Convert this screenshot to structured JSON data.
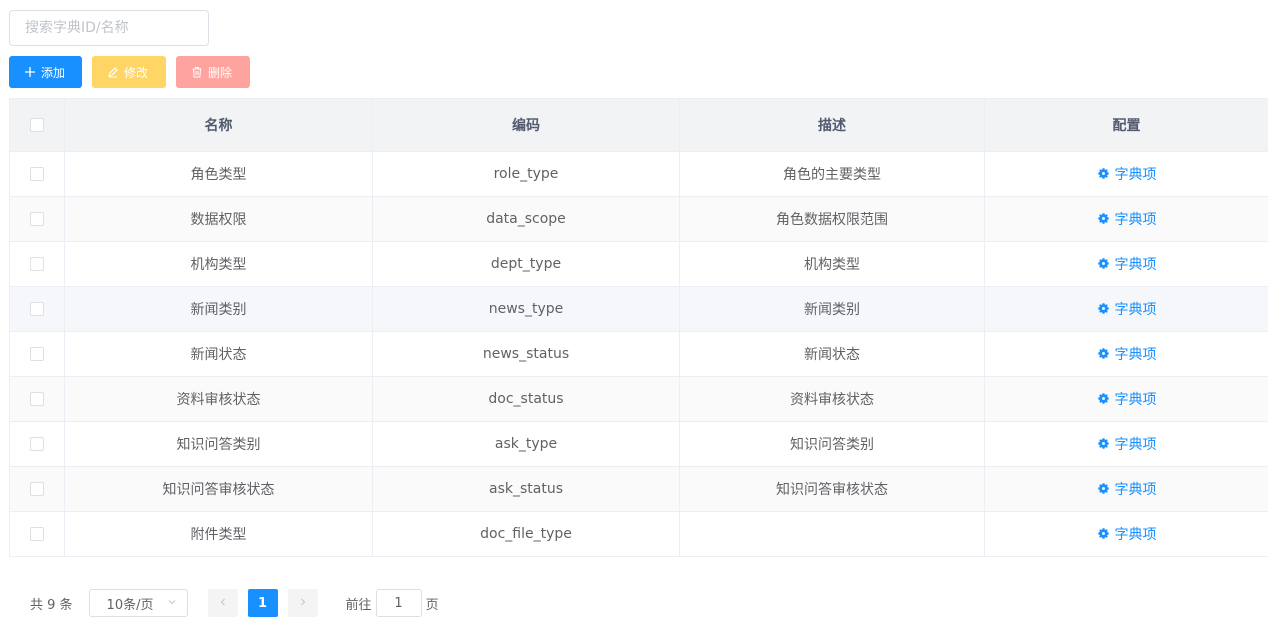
{
  "search": {
    "placeholder": "搜索字典ID/名称"
  },
  "toolbar": {
    "add_label": "添加",
    "edit_label": "修改",
    "delete_label": "删除",
    "add_color": "#1890ff",
    "edit_color": "#ffd666",
    "delete_color": "#ffa39e"
  },
  "table": {
    "headers": [
      "名称",
      "编码",
      "描述",
      "配置"
    ],
    "link_label": "字典项",
    "link_icon": "gear-icon",
    "rows": [
      {
        "name": "角色类型",
        "code": "role_type",
        "desc": "角色的主要类型"
      },
      {
        "name": "数据权限",
        "code": "data_scope",
        "desc": "角色数据权限范围"
      },
      {
        "name": "机构类型",
        "code": "dept_type",
        "desc": "机构类型"
      },
      {
        "name": "新闻类别",
        "code": "news_type",
        "desc": "新闻类别"
      },
      {
        "name": "新闻状态",
        "code": "news_status",
        "desc": "新闻状态"
      },
      {
        "name": "资料审核状态",
        "code": "doc_status",
        "desc": "资料审核状态"
      },
      {
        "name": "知识问答类别",
        "code": "ask_type",
        "desc": "知识问答类别"
      },
      {
        "name": "知识问答审核状态",
        "code": "ask_status",
        "desc": "知识问答审核状态"
      },
      {
        "name": "附件类型",
        "code": "doc_file_type",
        "desc": ""
      }
    ]
  },
  "pagination": {
    "total": "共 9 条",
    "page_size": "10条/页",
    "current_page": "1",
    "goto_prefix": "前往",
    "goto_value": "1",
    "goto_suffix": "页",
    "accent": "#1890ff"
  }
}
